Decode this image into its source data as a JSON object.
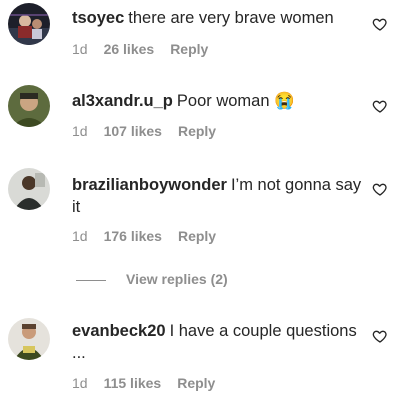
{
  "comments": [
    {
      "username": "tsoyec",
      "text": "there are very brave women",
      "time": "1d",
      "likes": "26 likes",
      "reply": "Reply",
      "avatar_icon": "avatar-boxing-ring"
    },
    {
      "username": "al3xandr.u_p",
      "text": "Poor woman",
      "emoji": "😭",
      "time": "1d",
      "likes": "107 likes",
      "reply": "Reply",
      "avatar_icon": "avatar-man-green"
    },
    {
      "username": "brazilianboywonder",
      "text": "I’m not gonna say it",
      "time": "1d",
      "likes": "176 likes",
      "reply": "Reply",
      "avatar_icon": "avatar-man-dark"
    },
    {
      "username": "evanbeck20",
      "text": "I have a couple questions ...",
      "time": "1d",
      "likes": "115 likes",
      "reply": "Reply",
      "avatar_icon": "avatar-man-shirt"
    }
  ],
  "view_replies": {
    "label": "View replies (2)"
  },
  "colors": {
    "text": "#262626",
    "secondary": "#8e8e8e",
    "background": "#ffffff"
  }
}
